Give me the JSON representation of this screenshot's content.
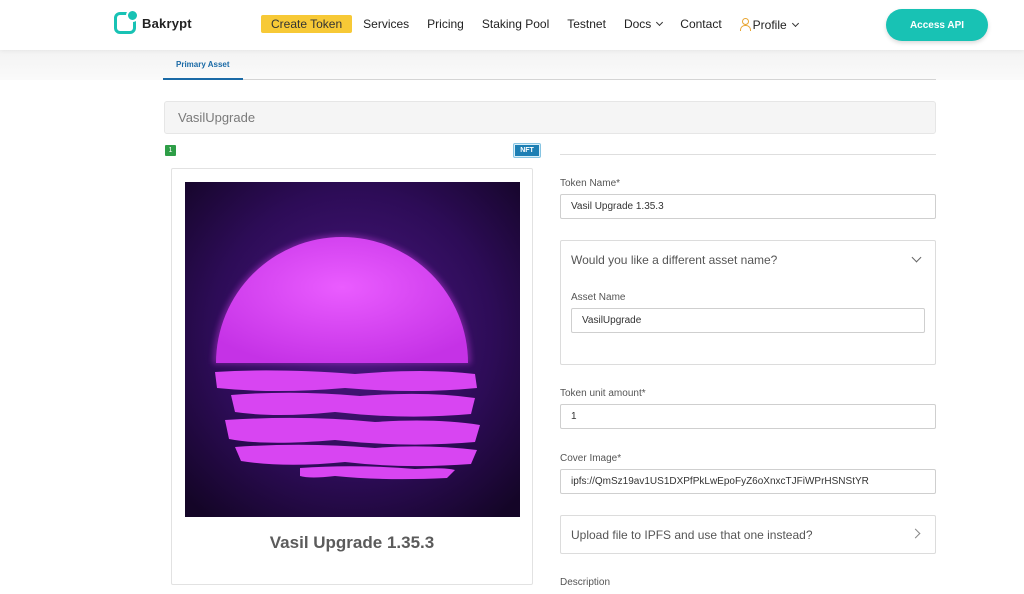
{
  "header": {
    "logo_text": "Bakrypt",
    "nav": {
      "create_token": "Create Token",
      "services": "Services",
      "pricing": "Pricing",
      "staking_pool": "Staking Pool",
      "testnet": "Testnet",
      "docs": "Docs",
      "contact": "Contact",
      "profile": "Profile"
    },
    "access_api": "Access API"
  },
  "tabs": {
    "primary_asset": "Primary Asset"
  },
  "asset": {
    "title": "VasilUpgrade",
    "index_badge": "1",
    "type_badge": "NFT",
    "preview_name": "Vasil Upgrade 1.35.3"
  },
  "form": {
    "token_name_label": "Token Name*",
    "token_name_value": "Vasil Upgrade 1.35.3",
    "different_name_question": "Would you like a different asset name?",
    "asset_name_label": "Asset Name",
    "asset_name_value": "VasilUpgrade",
    "unit_amount_label": "Token unit amount*",
    "unit_amount_value": "1",
    "cover_image_label": "Cover Image*",
    "cover_image_value": "ipfs://QmSz19av1US1DXPfPkLwEpoFyZ6oXnxcTJFiWPrHSNStYR",
    "upload_question": "Upload file to IPFS and use that one instead?",
    "description_label": "Description"
  },
  "colors": {
    "accent": "#18c2b4",
    "highlight": "#f7c936",
    "link_blue": "#1a6aa6",
    "art_background": "#2a0a4a",
    "art_sun": "#d63ff2"
  }
}
